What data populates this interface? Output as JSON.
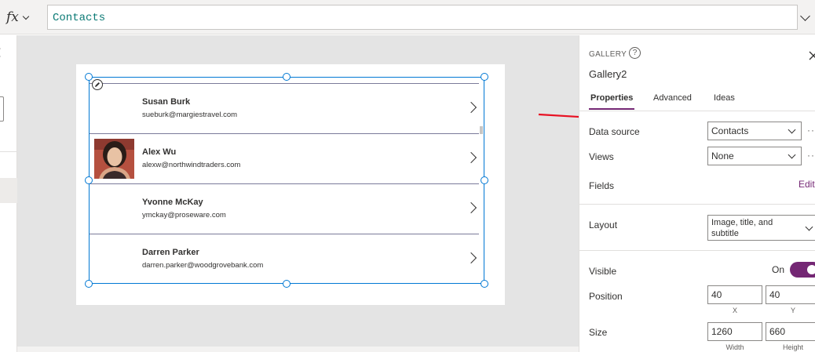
{
  "formula_bar": {
    "fx_label": "fx",
    "formula": "Contacts"
  },
  "gallery": {
    "rows": [
      {
        "title": "Susan Burk",
        "subtitle": "sueburk@margiestravel.com",
        "has_photo": false
      },
      {
        "title": "Alex Wu",
        "subtitle": "alexw@northwindtraders.com",
        "has_photo": true
      },
      {
        "title": "Yvonne McKay",
        "subtitle": "ymckay@proseware.com",
        "has_photo": false
      },
      {
        "title": "Darren Parker",
        "subtitle": "darren.parker@woodgrovebank.com",
        "has_photo": false
      }
    ]
  },
  "properties_panel": {
    "control_type": "GALLERY",
    "help_symbol": "?",
    "control_name": "Gallery2",
    "tabs": [
      "Properties",
      "Advanced",
      "Ideas"
    ],
    "active_tab": "Properties",
    "data_source": {
      "label": "Data source",
      "value": "Contacts"
    },
    "views": {
      "label": "Views",
      "value": "None"
    },
    "fields": {
      "label": "Fields",
      "action": "Edit"
    },
    "layout": {
      "label": "Layout",
      "value": "Image, title, and subtitle"
    },
    "visible": {
      "label": "Visible",
      "value": "On"
    },
    "position": {
      "label": "Position",
      "x": "40",
      "y": "40",
      "x_caption": "X",
      "y_caption": "Y"
    },
    "size": {
      "label": "Size",
      "width": "1260",
      "height": "660",
      "width_caption": "Width",
      "height_caption": "Height"
    },
    "more_symbol": "···"
  },
  "colors": {
    "accent": "#742774",
    "selection": "#0078d4",
    "annotation_arrow": "#e81123",
    "formula_text": "#0b7a75"
  }
}
